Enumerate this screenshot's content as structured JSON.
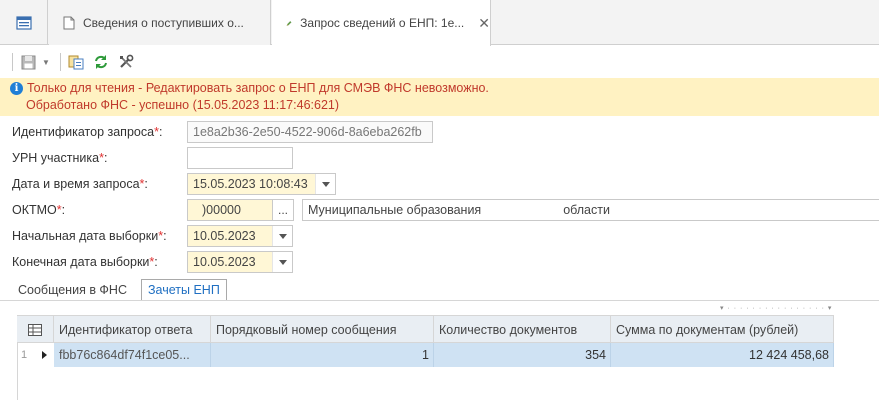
{
  "tabs": {
    "tab1_label": "Сведения о поступивших о...",
    "tab2_label": "Запрос сведений о ЕНП: 1е...",
    "close_symbol": "✕"
  },
  "banner": {
    "line1": "Только для чтения - Редактировать запрос о ЕНП для СМЭВ ФНС невозможно.",
    "line2": "Обработано ФНС - успешно (15.05.2023 11:17:46:621)"
  },
  "form": {
    "request_id_label": "Идентификатор запроса",
    "request_id_value": "1e8a2b36-2e50-4522-906d-8a6eba262fb",
    "urn_label": "УРН участника",
    "urn_value": "",
    "datetime_label": "Дата и время запроса",
    "datetime_value": "15.05.2023 10:08:43",
    "oktmo_label": "ОКТМО",
    "oktmo_value": ")00000",
    "oktmo_button": "...",
    "oktmo_desc_left": "Муниципальные образования",
    "oktmo_desc_right": "области",
    "start_date_label": "Начальная дата выборки",
    "start_date_value": "10.05.2023",
    "end_date_label": "Конечная дата выборки",
    "end_date_value": "10.05.2023",
    "required_mark": "*",
    "colon": ":"
  },
  "inner_tabs": {
    "tab1": "Сообщения в ФНС",
    "tab2": "Зачеты ЕНП"
  },
  "grid": {
    "columns": [
      "Идентификатор ответа",
      "Порядковый номер сообщения",
      "Количество документов",
      "Сумма по документам (рублей)"
    ],
    "rows": [
      {
        "row_number": "1",
        "response_id": "fbb76c864df74f1ce05...",
        "message_number": "1",
        "doc_count": "354",
        "doc_sum": "12 424 458,68"
      }
    ]
  },
  "colors": {
    "banner_bg": "#fff2c2",
    "banner_text": "#c0392b",
    "selected_row": "#cfe2f3",
    "required": "#e03030"
  }
}
